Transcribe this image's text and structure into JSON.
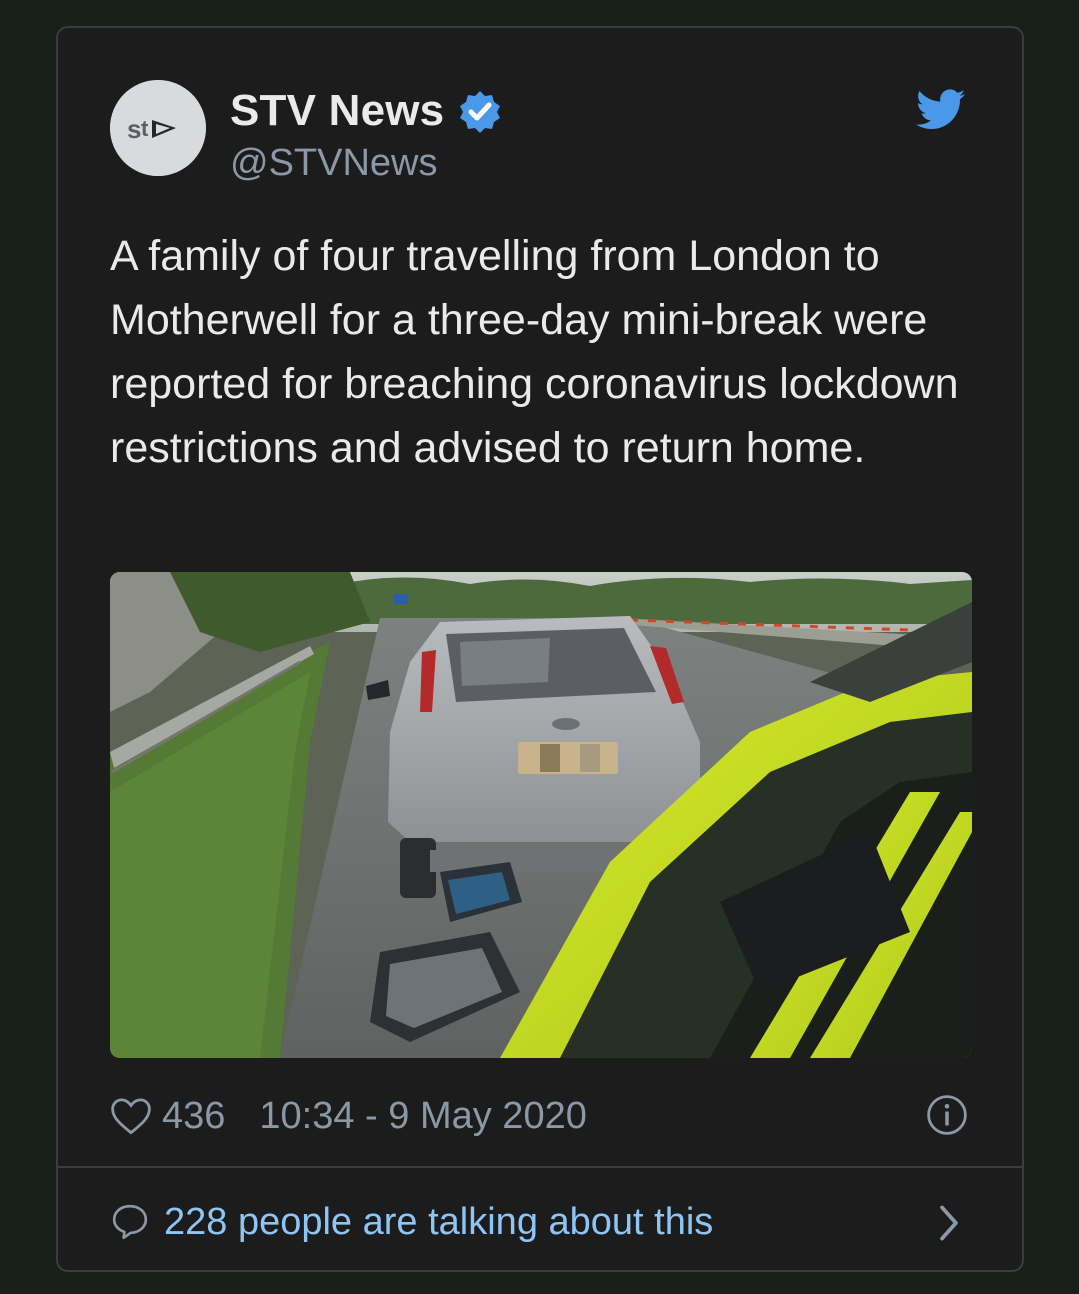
{
  "tweet": {
    "author_name": "STV News",
    "handle": "@STVNews",
    "verified": true,
    "avatar_logo_text": "stv",
    "text": "A family of four travelling from London to Motherwell for a three-day mini-break were reported for breaching coronavirus lockdown restrictions and advised to return home.",
    "like_count": "436",
    "timestamp": "10:34 - 9 May 2020",
    "conversation_label": "228 people are talking about this",
    "icons": {
      "platform": "twitter-bird-icon",
      "verified": "verified-badge-icon",
      "like": "heart-icon",
      "info": "info-icon",
      "reply": "speech-bubble-icon",
      "chevron": "chevron-right-icon"
    }
  },
  "colors": {
    "background": "#182019",
    "card": "#1c1c1d",
    "text": "#e8eaec",
    "muted": "#8b98a5",
    "link": "#8ec5f5",
    "accent": "#1d9bf0"
  }
}
